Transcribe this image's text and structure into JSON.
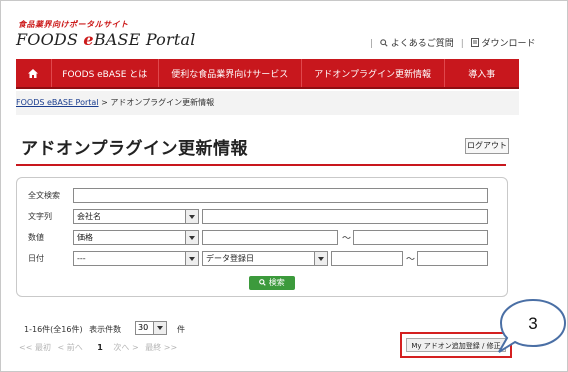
{
  "header": {
    "tagline": "食品業界向けポータルサイト",
    "brand_prefix": "FOODS ",
    "brand_e": "e",
    "brand_suffix": "BASE Portal",
    "faq_label": "よくあるご質問",
    "download_label": "ダウンロード"
  },
  "nav": {
    "items": [
      {
        "label": "FOODS eBASE とは"
      },
      {
        "label": "便利な食品業界向けサービス"
      },
      {
        "label": "アドオンプラグイン更新情報"
      },
      {
        "label": "導入事"
      }
    ]
  },
  "breadcrumb": {
    "home": "FOODS eBASE Portal",
    "separator": " > ",
    "current": "アドオンプラグイン更新情報"
  },
  "page": {
    "title": "アドオンプラグイン更新情報",
    "logout_label": "ログアウト"
  },
  "search": {
    "fulltext_label": "全文検索",
    "fulltext_value": "",
    "string_label": "文字列",
    "string_select": "会社名",
    "string_value": "",
    "number_label": "数値",
    "number_select": "価格",
    "number_from": "",
    "number_to": "",
    "date_label": "日付",
    "date_select": "---",
    "date_select2": "データ登録日",
    "date_from": "",
    "date_to": "",
    "tilde": "～",
    "search_button": "検索"
  },
  "results": {
    "count_text": "1-16件(全16件)",
    "per_page_label": "表示件数",
    "per_page_value": "30",
    "unit": "件",
    "pager_first": "<< 最初",
    "pager_prev": "< 前へ",
    "pager_current": "1",
    "pager_next": "次へ >",
    "pager_last": "最終 >>",
    "addon_button": "My アドオン追加登録 / 修正"
  },
  "callout": {
    "number": "3"
  },
  "colors": {
    "brand_red": "#c8171d",
    "search_green": "#3c9a3c",
    "callout_border": "#4a6fa5"
  }
}
